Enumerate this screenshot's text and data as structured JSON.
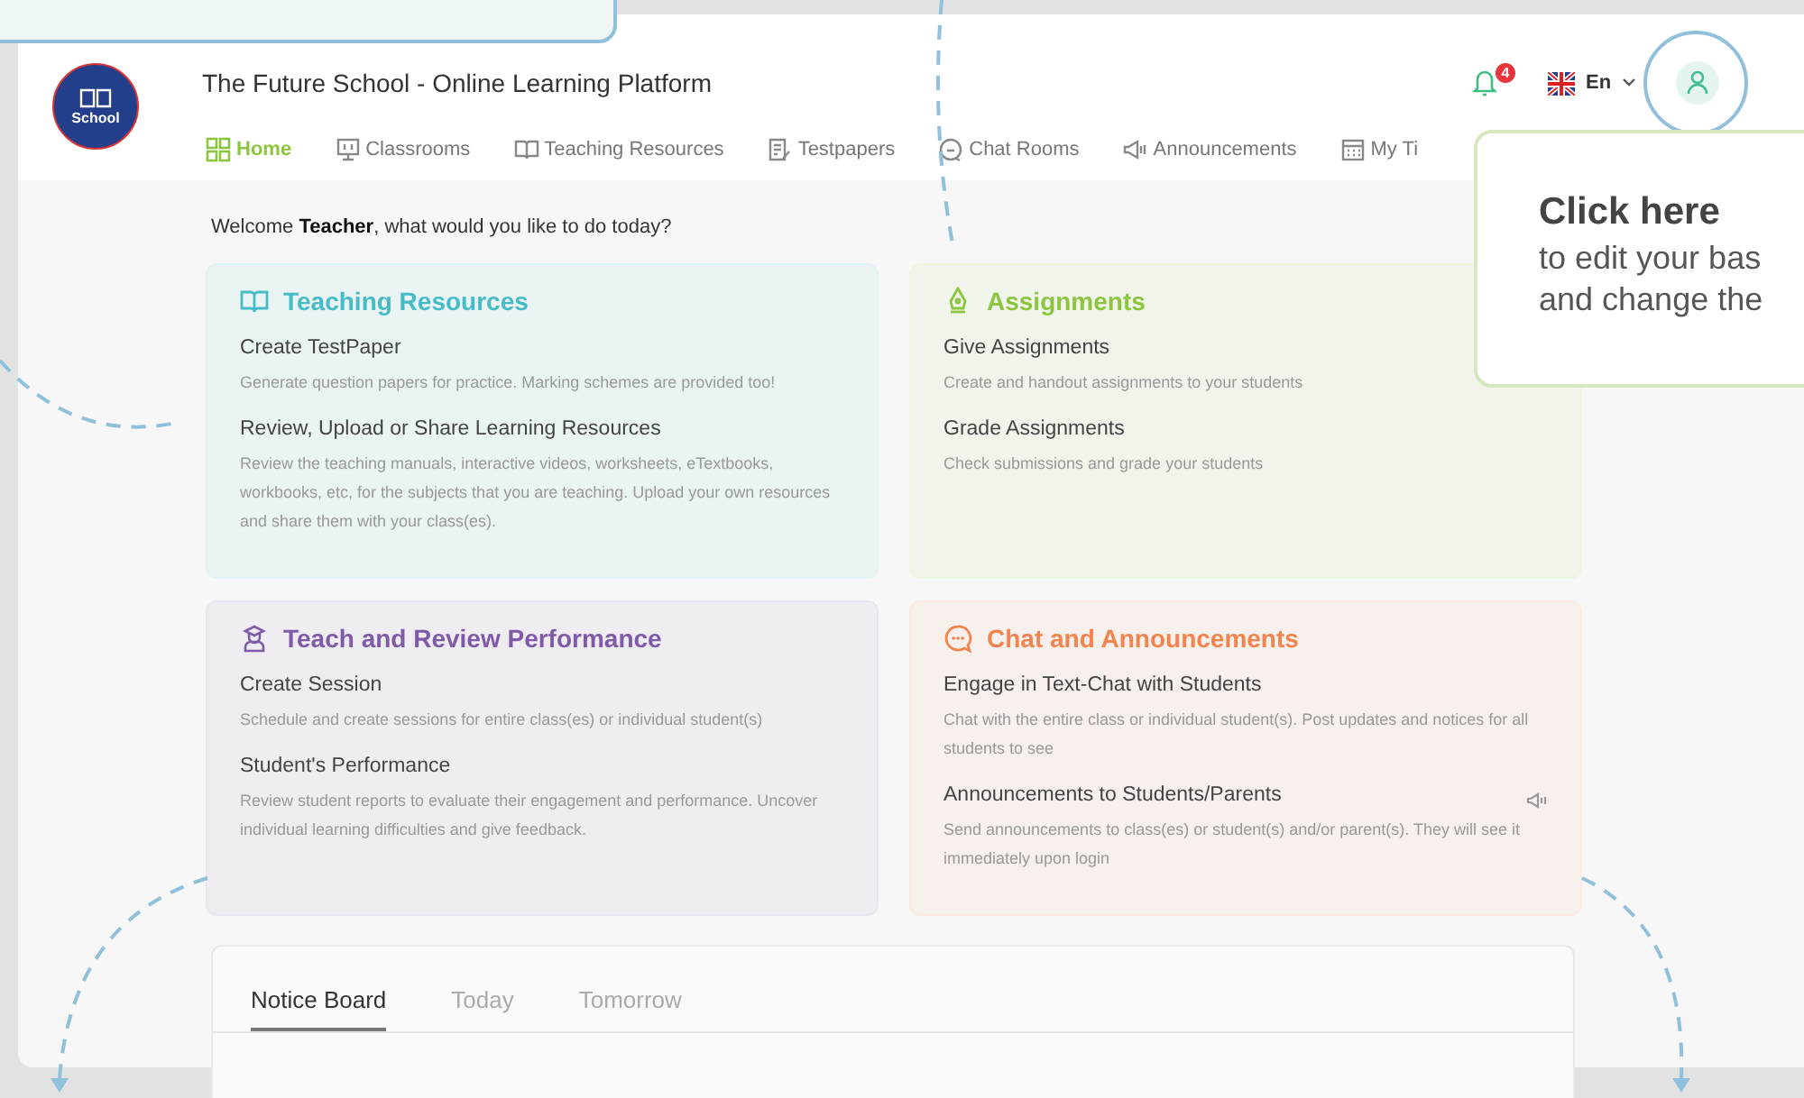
{
  "header": {
    "logo_text": "School",
    "title": "The Future School - Online Learning Platform",
    "notification_count": "4",
    "language": "En"
  },
  "nav": [
    {
      "kind": "home",
      "label": "Home",
      "selected": true
    },
    {
      "kind": "classrooms",
      "label": "Classrooms",
      "selected": false
    },
    {
      "kind": "resources",
      "label": "Teaching Resources",
      "selected": false
    },
    {
      "kind": "testpapers",
      "label": "Testpapers",
      "selected": false
    },
    {
      "kind": "chat",
      "label": "Chat Rooms",
      "selected": false
    },
    {
      "kind": "announcements",
      "label": "Announcements",
      "selected": false
    },
    {
      "kind": "timetable",
      "label": "My Ti",
      "selected": false
    }
  ],
  "welcome": "Welcome **Teacher**, what would you like to do today?",
  "cards": [
    {
      "kind": "book",
      "title": "Teaching Resources",
      "color": "#45bcc6",
      "items": [
        {
          "title": "Create TestPaper",
          "description": "Generate question papers for practice. Marking schemes are provided too!"
        },
        {
          "title": "Review, Upload or Share Learning Resources",
          "description": "Review the teaching manuals, interactive videos, worksheets, eTextbooks, workbooks, etc, for the subjects that you are teaching. Upload your own resources and share them with your class(es)."
        }
      ]
    },
    {
      "kind": "pen",
      "title": "Assignments",
      "color": "#8cc53e",
      "items": [
        {
          "title": "Give Assignments",
          "description": "Create and handout assignments to your students"
        },
        {
          "title": "Grade Assignments",
          "description": "Check submissions and grade your students"
        }
      ]
    },
    {
      "kind": "teacher",
      "title": "Teach and Review Performance",
      "color": "#7f5aa8",
      "items": [
        {
          "title": "Create Session",
          "description": "Schedule and create sessions for entire class(es) or individual student(s)"
        },
        {
          "title": "Student's Performance",
          "description": "Review student reports to evaluate their engagement and performance. Uncover individual learning difficulties and give feedback."
        }
      ]
    },
    {
      "kind": "chat",
      "title": "Chat and Announcements",
      "color": "#f3844f",
      "items": [
        {
          "title": "Engage in Text-Chat with Students",
          "description": "Chat with the entire class or individual student(s). Post updates and notices for all students to see",
          "megaphone": false
        },
        {
          "title": "Announcements to Students/Parents",
          "description": "Send announcements to class(es) or student(s) and/or parent(s). They will see it immediately upon login",
          "megaphone": true
        }
      ]
    }
  ],
  "notice_board": {
    "tabs": [
      {
        "label": "Notice Board",
        "selected": true
      },
      {
        "label": "Today",
        "selected": false
      },
      {
        "label": "Tomorrow",
        "selected": false
      }
    ]
  },
  "tutorial": {
    "callout_title": "Click here",
    "callout_lines": [
      "to edit your bas",
      "and change the"
    ]
  }
}
